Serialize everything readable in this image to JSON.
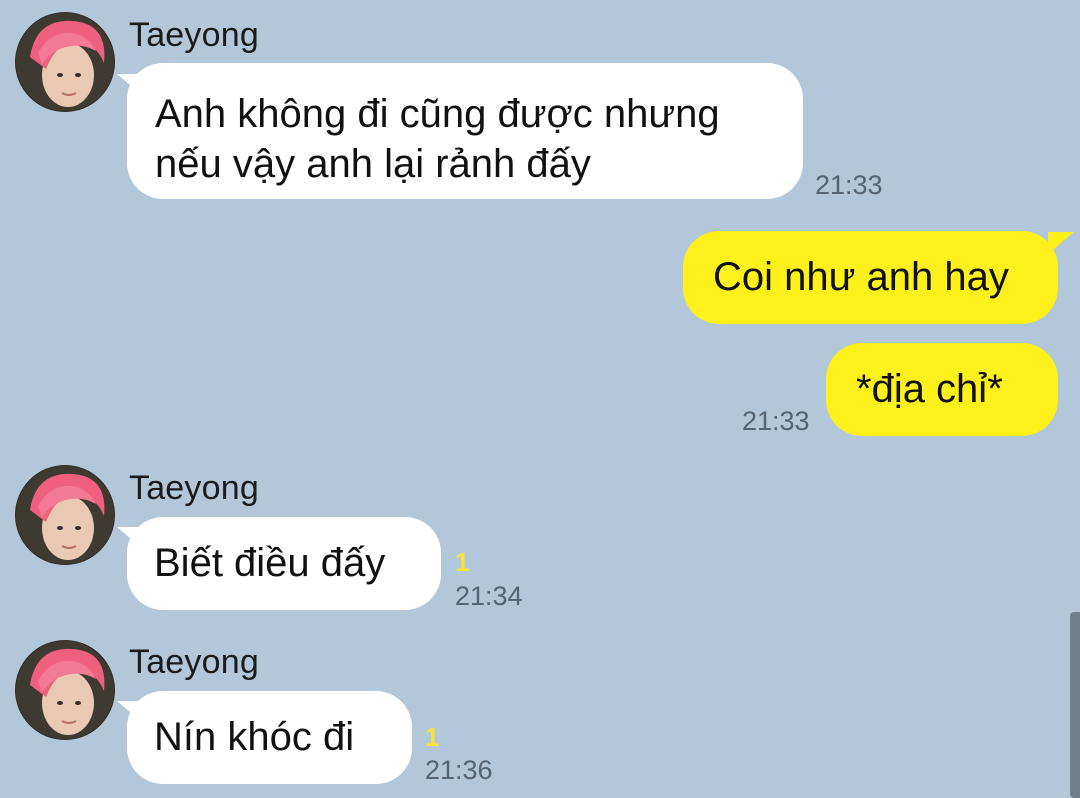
{
  "conversation": {
    "messages": [
      {
        "sender": "Taeyong",
        "lines": [
          "Anh không đi cũng được nhưng",
          "nếu vậy anh lại rảnh đấy"
        ],
        "time": "21:33"
      },
      {
        "text": "Coi như anh hay"
      },
      {
        "text": "*địa chỉ*",
        "time": "21:33"
      },
      {
        "sender": "Taeyong",
        "text": "Biết điều đấy",
        "unread": "1",
        "time": "21:34"
      },
      {
        "sender": "Taeyong",
        "text": "Nín khóc đi",
        "unread": "1",
        "time": "21:36"
      }
    ]
  },
  "colors": {
    "background": "#b2c7d9",
    "incoming_bubble": "#ffffff",
    "outgoing_bubble": "#fef01b",
    "unread_count": "#f6e23a",
    "timestamp": "#556473"
  },
  "icons": {
    "avatar": "profile-photo-icon"
  }
}
